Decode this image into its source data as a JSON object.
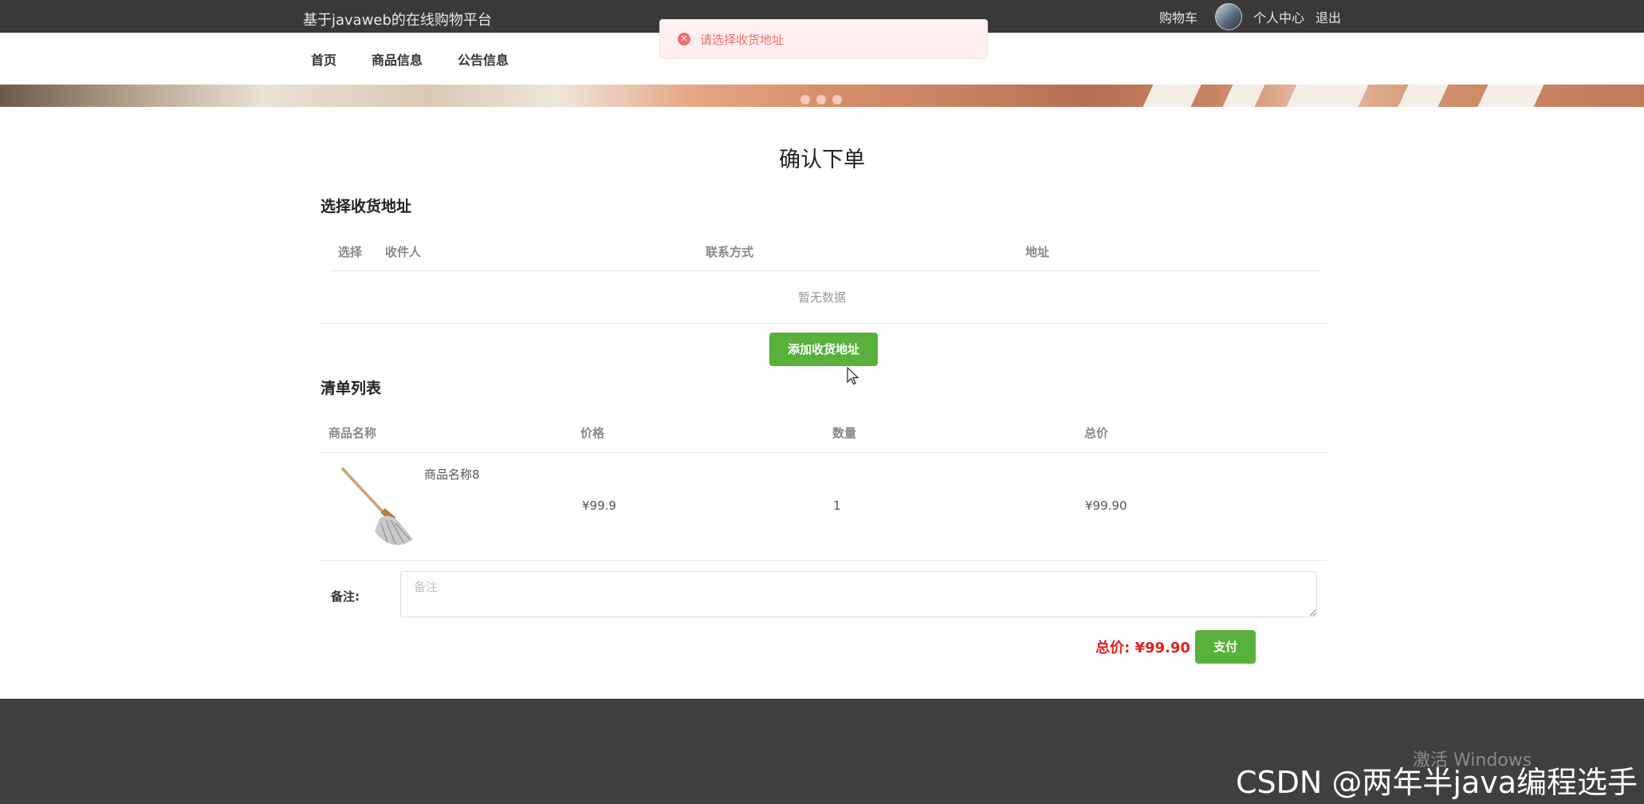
{
  "header": {
    "site_title": "基于javaweb的在线购物平台",
    "cart": "购物车",
    "user_center": "个人中心",
    "logout": "退出"
  },
  "nav": {
    "items": [
      "首页",
      "商品信息",
      "公告信息"
    ]
  },
  "toast": {
    "message": "请选择收货地址",
    "icon": "error-icon",
    "color": "#f56c6c"
  },
  "page": {
    "title": "确认下单"
  },
  "address_section": {
    "title": "选择收货地址",
    "columns": [
      "选择",
      "收件人",
      "联系方式",
      "地址"
    ],
    "empty_text": "暂无数据",
    "add_button": "添加收货地址"
  },
  "order_section": {
    "title": "清单列表",
    "columns": [
      "商品名称",
      "价格",
      "数量",
      "总价"
    ],
    "rows": [
      {
        "name": "商品名称8",
        "price": "¥99.9",
        "quantity": "1",
        "total": "¥99.90",
        "image": "mop-image"
      }
    ]
  },
  "remark": {
    "label": "备注:",
    "placeholder": "备注"
  },
  "summary": {
    "total": "总价: ¥99.90",
    "pay_button": "支付"
  },
  "watermarks": {
    "windows": "激活 Windows",
    "csdn": "CSDN @两年半java编程选手"
  },
  "colors": {
    "accent_green": "#57b13a",
    "top_bar": "#393939",
    "footer": "#3f3f3f",
    "total_red": "#e02020"
  }
}
